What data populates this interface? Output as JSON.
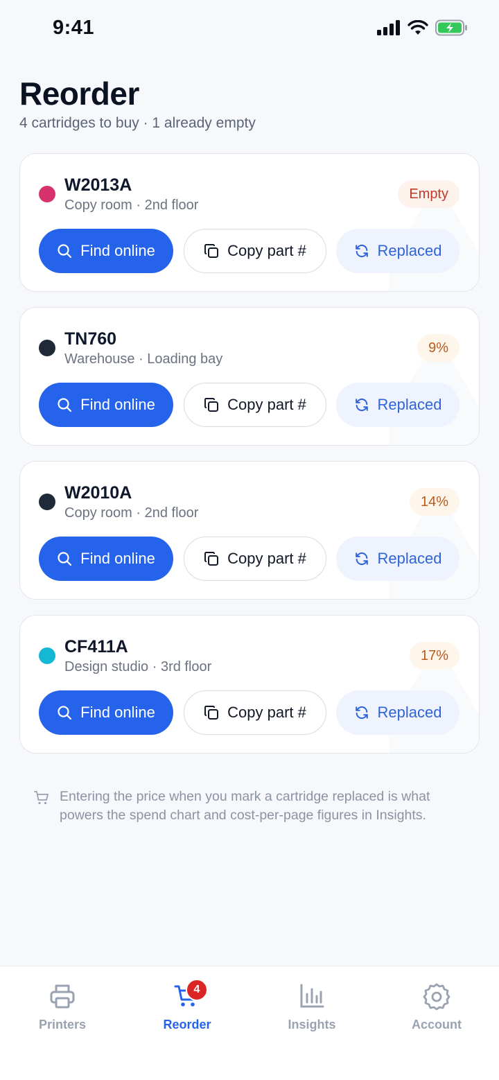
{
  "status_bar": {
    "time": "9:41"
  },
  "header": {
    "title": "Reorder",
    "subtitle": "4 cartridges to buy · 1 already empty"
  },
  "colors": {
    "accent": "#2563eb",
    "magenta": "#d6336c",
    "black": "#1f2937",
    "cyan": "#14b8d4"
  },
  "cartridges": [
    {
      "part": "W2013A",
      "location": "Copy room · 2nd floor",
      "status": "Empty",
      "dot_color": "#d6336c"
    },
    {
      "part": "TN760",
      "location": "Warehouse · Loading bay",
      "status": "9%",
      "dot_color": "#1f2937"
    },
    {
      "part": "W2010A",
      "location": "Copy room · 2nd floor",
      "status": "14%",
      "dot_color": "#1f2937"
    },
    {
      "part": "CF411A",
      "location": "Design studio · 3rd floor",
      "status": "17%",
      "dot_color": "#14b8d4"
    }
  ],
  "actions": {
    "find_online": "Find online",
    "copy_part": "Copy part #",
    "replaced": "Replaced"
  },
  "hint": {
    "icon": "cart-icon",
    "text": "Entering the price when you mark a cartridge replaced is what powers the spend chart and cost-per-page figures in Insights."
  },
  "nav": {
    "items": [
      {
        "label": "Printers",
        "icon": "printer-icon"
      },
      {
        "label": "Reorder",
        "icon": "cart-icon",
        "badge": "4",
        "active": true
      },
      {
        "label": "Insights",
        "icon": "bar-chart-icon"
      },
      {
        "label": "Account",
        "icon": "gear-icon"
      }
    ]
  }
}
